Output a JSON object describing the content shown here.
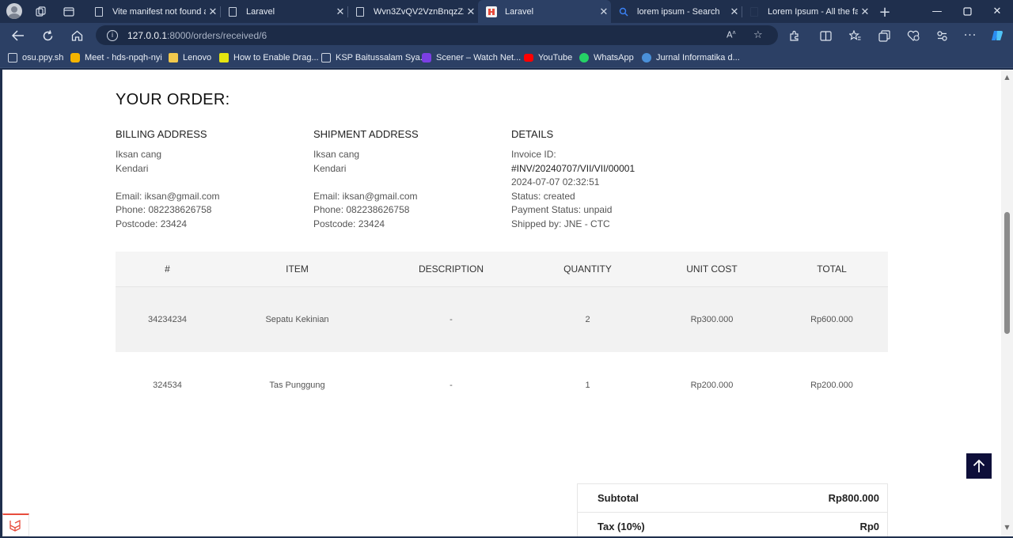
{
  "browser": {
    "tabs": [
      {
        "title": "Vite manifest not found a",
        "favicon": "document-icon"
      },
      {
        "title": "Laravel",
        "favicon": "document-icon"
      },
      {
        "title": "Wvn3ZvQV2VznBnqzZxlD",
        "favicon": "document-icon"
      },
      {
        "title": "Laravel",
        "favicon": "laravel-icon",
        "active": true
      },
      {
        "title": "lorem ipsum - Search",
        "favicon": "search-icon"
      },
      {
        "title": "Lorem Ipsum - All the fac",
        "favicon": "document-icon"
      }
    ],
    "url": {
      "host": "127.0.0.1",
      "rest": ":8000/orders/received/6"
    },
    "bookmarks": [
      {
        "label": "osu.ppy.sh",
        "color": "#ffffff"
      },
      {
        "label": "Meet - hds-npqh-nyi",
        "color": "#f4b400"
      },
      {
        "label": "Lenovo",
        "color": "#f2c94c"
      },
      {
        "label": "How to Enable Drag...",
        "color": "#e5e510"
      },
      {
        "label": "KSP Baitussalam Sya...",
        "color": "#ffffff"
      },
      {
        "label": "Scener – Watch Net...",
        "color": "#7b3fe4"
      },
      {
        "label": "YouTube",
        "color": "#ff0000"
      },
      {
        "label": "WhatsApp",
        "color": "#25d366"
      },
      {
        "label": "Jurnal Informatika d...",
        "color": "#4a90d9"
      }
    ]
  },
  "order": {
    "heading": "YOUR ORDER:",
    "billing": {
      "title": "BILLING ADDRESS",
      "name": "Iksan cang",
      "city": "Kendari",
      "email": "Email: iksan@gmail.com",
      "phone": "Phone: 082238626758",
      "postcode": "Postcode: 23424"
    },
    "shipment": {
      "title": "SHIPMENT ADDRESS",
      "name": "Iksan cang",
      "city": "Kendari",
      "email": "Email: iksan@gmail.com",
      "phone": "Phone: 082238626758",
      "postcode": "Postcode: 23424"
    },
    "details": {
      "title": "DETAILS",
      "invoice_label": "Invoice ID:",
      "invoice_id": "#INV/20240707/VII/VII/00001",
      "date": "2024-07-07 02:32:51",
      "status": "Status: created",
      "payment_status": "Payment Status: unpaid",
      "shipped_by": "Shipped by: JNE - CTC"
    },
    "table": {
      "headers": [
        "#",
        "ITEM",
        "DESCRIPTION",
        "QUANTITY",
        "UNIT COST",
        "TOTAL"
      ],
      "rows": [
        [
          "34234234",
          "Sepatu Kekinian",
          "-",
          "2",
          "Rp300.000",
          "Rp600.000"
        ],
        [
          "324534",
          "Tas Punggung",
          "-",
          "1",
          "Rp200.000",
          "Rp200.000"
        ]
      ]
    },
    "totals": {
      "subtotal_label": "Subtotal",
      "subtotal_value": "Rp800.000",
      "tax_label": "Tax (10%)",
      "tax_value": "Rp0"
    }
  }
}
